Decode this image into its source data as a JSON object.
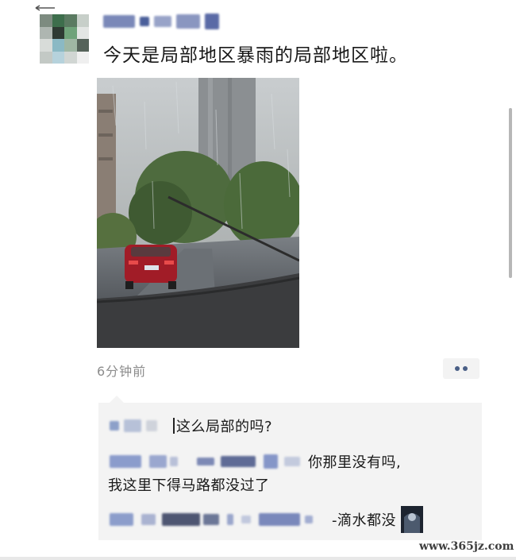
{
  "post": {
    "text": "今天是局部地区暴雨的局部地区啦。",
    "time": "6分钟前"
  },
  "comments": [
    {
      "reply": "这么局部的吗?"
    },
    {
      "reply_line1": "你那里没有吗,",
      "reply_line2": "我这里下得马路都没过了"
    },
    {
      "reply": "-滴水都没"
    }
  ],
  "watermark": "www.365jz.com",
  "colors": {
    "link_blue": "#4a5f86",
    "comment_bg": "#f3f3f3",
    "time_gray": "#8c8c8c"
  }
}
